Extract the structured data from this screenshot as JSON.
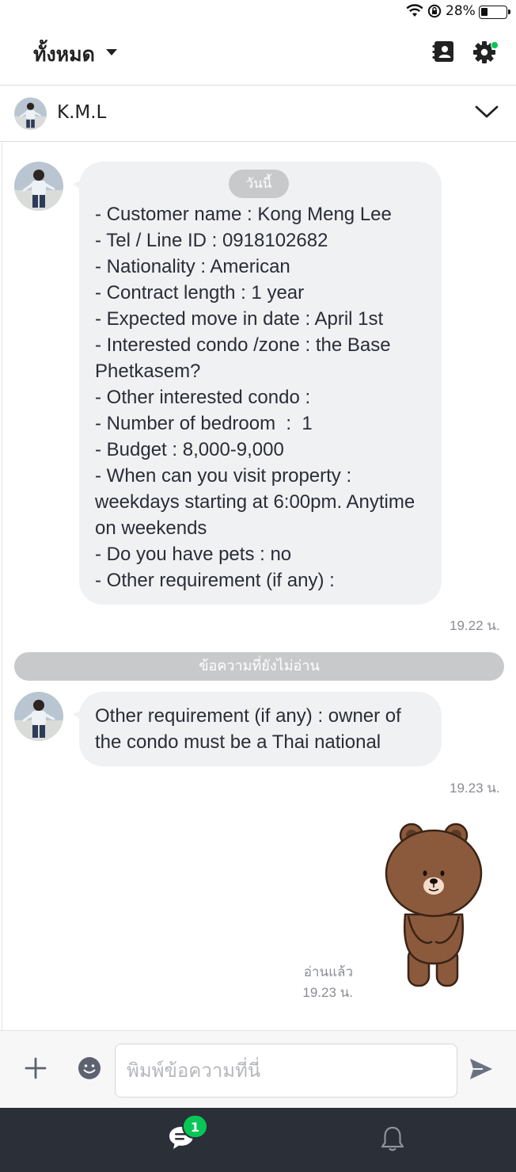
{
  "status_bar": {
    "battery_text": "28%",
    "battery_level": 0.28
  },
  "header": {
    "title": "ทั้งหมด"
  },
  "chat": {
    "contact_name": "K.M.L"
  },
  "messages": [
    {
      "date_pill": "วันนี้",
      "lines": [
        "- Customer name : Kong Meng Lee",
        "- Tel / Line ID : 0918102682",
        "- Nationality : American",
        "- Contract length : 1 year",
        "- Expected move in date : April 1st",
        "- Interested condo /zone : the Base Phetkasem?",
        "- Other interested condo :",
        "- Number of bedroom  :  1",
        "- Budget : 8,000-9,000",
        "- When can you visit property : weekdays starting at 6:00pm. Anytime on weekends",
        "- Do you have pets : no",
        "- Other requirement (if any) :"
      ],
      "time": "19.22 น."
    },
    {
      "lines": [
        "Other requirement (if any) : owner of the condo must be a Thai national"
      ],
      "time": "19.23 น."
    }
  ],
  "unread_divider": "ข้อความที่ยังไม่อ่าน",
  "sent_sticker": {
    "read_label": "อ่านแล้ว",
    "time": "19.23 น."
  },
  "input": {
    "placeholder": "พิมพ์ข้อความที่นี่",
    "value": ""
  },
  "bottom_nav": {
    "chat_badge": "1"
  },
  "colors": {
    "accent": "#06c755",
    "bubble": "#f0f1f3",
    "nav_bg": "#2b2f38",
    "pill": "#c8c9cb"
  }
}
